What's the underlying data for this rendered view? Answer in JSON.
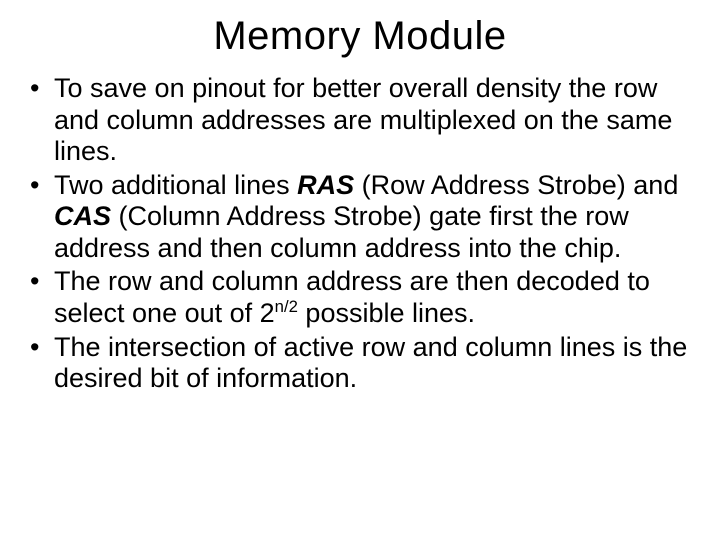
{
  "title": "Memory Module",
  "bullets": {
    "b1": "To save on pinout for better overall density the row and column addresses are multiplexed on the same lines.",
    "b2_pre": "Two additional lines ",
    "b2_ras": "RAS",
    "b2_ras_exp": " (Row Address Strobe) and ",
    "b2_cas": "CAS",
    "b2_cas_exp": " (Column Address Strobe) gate first the row address and then column address into the chip.",
    "b3_pre": "The row and column address are then decoded to select one out of 2",
    "b3_sup": "n/2",
    "b3_post": " possible lines.",
    "b4": "The intersection of active row and column lines is the desired bit of information."
  }
}
